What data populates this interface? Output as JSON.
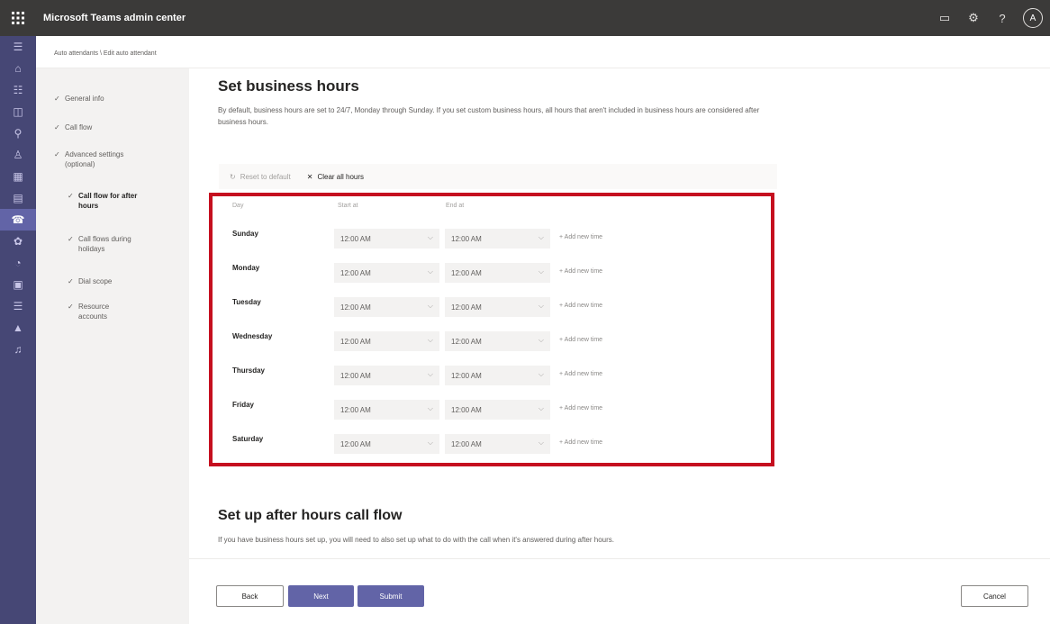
{
  "app": {
    "title": "Microsoft Teams admin center",
    "waffle_icon": "waffle-icon",
    "avatar_initial": "A"
  },
  "breadcrumb": "Auto attendants \\ Edit auto attendant",
  "subnav": [
    {
      "label": "General info"
    },
    {
      "label": "Call flow"
    },
    {
      "label": "Advanced settings (optional)"
    },
    {
      "label": "Call flow for after hours"
    },
    {
      "label": "Call flows during holidays"
    },
    {
      "label": "Dial scope"
    },
    {
      "label": "Resource accounts"
    }
  ],
  "section1": {
    "title": "Set business hours",
    "description": "By default, business hours are set to 24/7, Monday through Sunday. If you set custom business hours, all hours that aren't included in business hours are considered after business hours."
  },
  "toolbar": {
    "reset": "Reset to default",
    "clear": "Clear all hours"
  },
  "grid": {
    "headers": {
      "day": "Day",
      "start": "Start at",
      "end": "End at"
    },
    "add_time_label": "+ Add new time",
    "rows": [
      {
        "day": "Sunday",
        "start": "12:00 AM",
        "end": "12:00 AM"
      },
      {
        "day": "Monday",
        "start": "12:00 AM",
        "end": "12:00 AM"
      },
      {
        "day": "Tuesday",
        "start": "12:00 AM",
        "end": "12:00 AM"
      },
      {
        "day": "Wednesday",
        "start": "12:00 AM",
        "end": "12:00 AM"
      },
      {
        "day": "Thursday",
        "start": "12:00 AM",
        "end": "12:00 AM"
      },
      {
        "day": "Friday",
        "start": "12:00 AM",
        "end": "12:00 AM"
      },
      {
        "day": "Saturday",
        "start": "12:00 AM",
        "end": "12:00 AM"
      }
    ]
  },
  "section2": {
    "title": "Set up after hours call flow",
    "description": "If you have business hours set up, you will need to also set up what to do with the call when it's answered during after hours."
  },
  "footer": {
    "back": "Back",
    "next": "Next",
    "submit": "Submit",
    "cancel": "Cancel"
  },
  "colors": {
    "topbar": "#3b3a39",
    "rail": "#464775",
    "accent": "#6264a7",
    "highlight": "#c50f1f"
  }
}
